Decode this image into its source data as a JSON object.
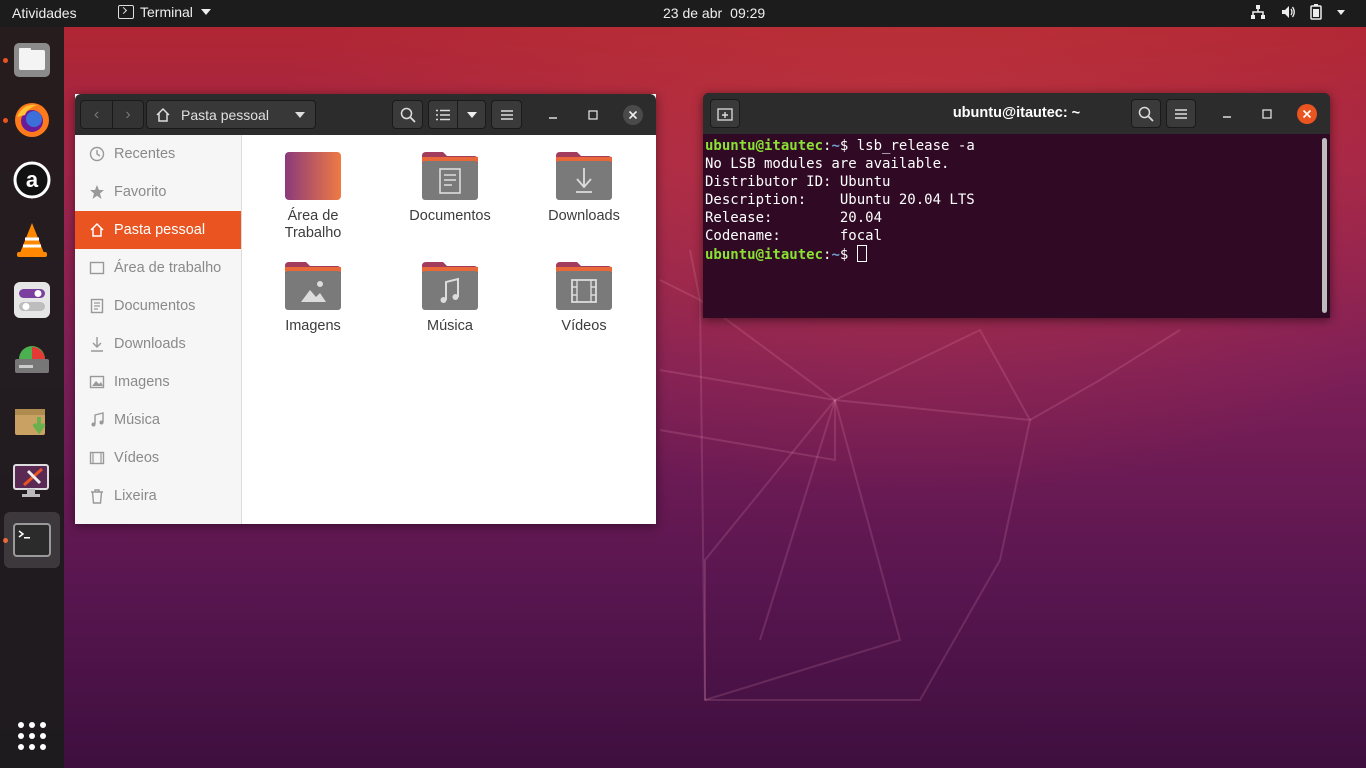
{
  "topbar": {
    "activities": "Atividades",
    "app_name": "Terminal",
    "date": "23 de abr",
    "time": "09:29"
  },
  "dock": {
    "items": [
      "files-icon",
      "firefox-icon",
      "app-a-icon",
      "vlc-icon",
      "tweaks-icon",
      "disk-usage-icon",
      "archive-install-icon",
      "screen-settings-icon",
      "terminal-icon"
    ],
    "show_apps": "app-grid-icon"
  },
  "files": {
    "path_label": "Pasta pessoal",
    "sidebar": [
      {
        "label": "Recentes",
        "icon": "clock-icon"
      },
      {
        "label": "Favorito",
        "icon": "star-icon"
      },
      {
        "label": "Pasta pessoal",
        "icon": "home-icon"
      },
      {
        "label": "Área de trabalho",
        "icon": "desktop-icon"
      },
      {
        "label": "Documentos",
        "icon": "document-icon"
      },
      {
        "label": "Downloads",
        "icon": "download-icon"
      },
      {
        "label": "Imagens",
        "icon": "image-icon"
      },
      {
        "label": "Música",
        "icon": "music-icon"
      },
      {
        "label": "Vídeos",
        "icon": "video-icon"
      },
      {
        "label": "Lixeira",
        "icon": "trash-icon"
      }
    ],
    "folders": [
      {
        "line1": "Área de",
        "line2": "Trabalho",
        "icon": "desktop-folder-icon"
      },
      {
        "line1": "Documentos",
        "line2": "",
        "icon": "documents-folder-icon"
      },
      {
        "line1": "Downloads",
        "line2": "",
        "icon": "downloads-folder-icon"
      },
      {
        "line1": "Imagens",
        "line2": "",
        "icon": "pictures-folder-icon"
      },
      {
        "line1": "Música",
        "line2": "",
        "icon": "music-folder-icon"
      },
      {
        "line1": "Vídeos",
        "line2": "",
        "icon": "videos-folder-icon"
      }
    ]
  },
  "terminal": {
    "title": "ubuntu@itautec: ~",
    "prompt_user": "ubuntu@itautec",
    "prompt_path": "~",
    "prompt_symbol": "$ ",
    "command": "lsb_release -a",
    "output": [
      "No LSB modules are available.",
      "Distributor ID: Ubuntu",
      "Description:    Ubuntu 20.04 LTS",
      "Release:        20.04",
      "Codename:       focal"
    ]
  },
  "colors": {
    "accent": "#e95420",
    "terminal_bg": "#300a24",
    "prompt_user": "#8ae234",
    "prompt_path": "#729fcf"
  }
}
